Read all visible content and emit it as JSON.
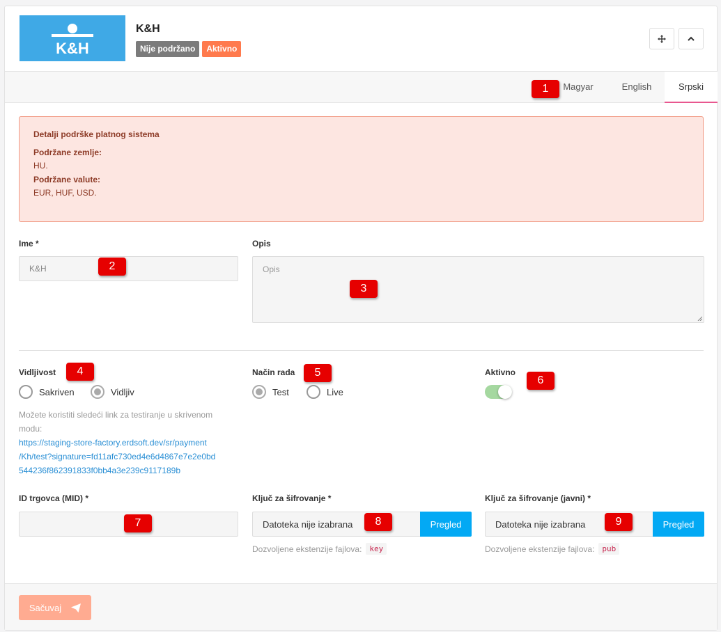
{
  "header": {
    "logo_text": "K&H",
    "title": "K&H",
    "badge_unsupported": "Nije podržano",
    "badge_active": "Aktivno"
  },
  "tabs": [
    "Magyar",
    "English",
    "Srpski"
  ],
  "alert": {
    "heading": "Detalji podrške platnog sistema",
    "countries_label": "Podržane zemlje:",
    "countries_value": "HU.",
    "currencies_label": "Podržane valute:",
    "currencies_value": "EUR, HUF, USD."
  },
  "form": {
    "name_label": "Ime *",
    "name_value": "K&H",
    "desc_label": "Opis",
    "desc_placeholder": "Opis",
    "visibility_label": "Vidljivost",
    "visibility_options": [
      "Sakriven",
      "Vidljiv"
    ],
    "visibility_selected": "Vidljiv",
    "visibility_hint_1": "Možete koristiti sledeći link za testiranje u skrivenom",
    "visibility_hint_2": "modu:",
    "test_link_1": "https://staging-store-factory.erdsoft.dev/sr/payment",
    "test_link_2": "/Kh/test?signature=fd11afc730ed4e6d4867e7e2e0bd",
    "test_link_3": "544236f862391833f0bb4a3e239c9117189b",
    "mode_label": "Način rada",
    "mode_options": [
      "Test",
      "Live"
    ],
    "mode_selected": "Test",
    "active_label": "Aktivno",
    "active_on": true,
    "mid_label": "ID trgovca (MID) *",
    "mid_value": "",
    "key_label": "Ključ za šifrovanje *",
    "key_file": "Datoteka nije izabrana",
    "key_button": "Pregled",
    "key_ext_label": "Dozvoljene ekstenzije fajlova:",
    "key_ext": "key",
    "pubkey_label": "Ključ za šifrovanje (javni) *",
    "pubkey_file": "Datoteka nije izabrana",
    "pubkey_button": "Pregled",
    "pubkey_ext_label": "Dozvoljene ekstenzije fajlova:",
    "pubkey_ext": "pub"
  },
  "footer": {
    "save_label": "Sačuvaj"
  },
  "markers": [
    "1",
    "2",
    "3",
    "4",
    "5",
    "6",
    "7",
    "8",
    "9"
  ],
  "colors": {
    "logo_bg": "#3fa9e6",
    "badge_grey": "#7b7b7b",
    "badge_orange": "#ff7a4d",
    "alert_bg": "#fde6e1",
    "alert_text": "#8d3b27",
    "tab_active": "#e8578f",
    "button_blue": "#03a9f4",
    "save_button": "#ffab91",
    "marker_red": "#e60000"
  }
}
